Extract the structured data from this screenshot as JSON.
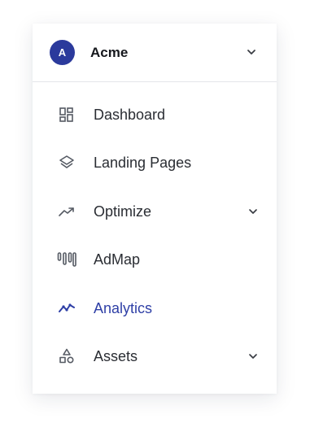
{
  "org": {
    "avatar_letter": "A",
    "name": "Acme"
  },
  "nav": {
    "items": [
      {
        "label": "Dashboard",
        "icon": "dashboard-icon",
        "has_submenu": false,
        "active": false
      },
      {
        "label": "Landing Pages",
        "icon": "layers-icon",
        "has_submenu": false,
        "active": false
      },
      {
        "label": "Optimize",
        "icon": "trending-up-icon",
        "has_submenu": true,
        "active": false
      },
      {
        "label": "AdMap",
        "icon": "admap-icon",
        "has_submenu": false,
        "active": false
      },
      {
        "label": "Analytics",
        "icon": "analytics-icon",
        "has_submenu": false,
        "active": true
      },
      {
        "label": "Assets",
        "icon": "shapes-icon",
        "has_submenu": true,
        "active": false
      }
    ]
  },
  "colors": {
    "accent": "#2e3fa6",
    "avatar_bg": "#2b3a9c",
    "text": "#2a2d33",
    "icon": "#555a63"
  }
}
